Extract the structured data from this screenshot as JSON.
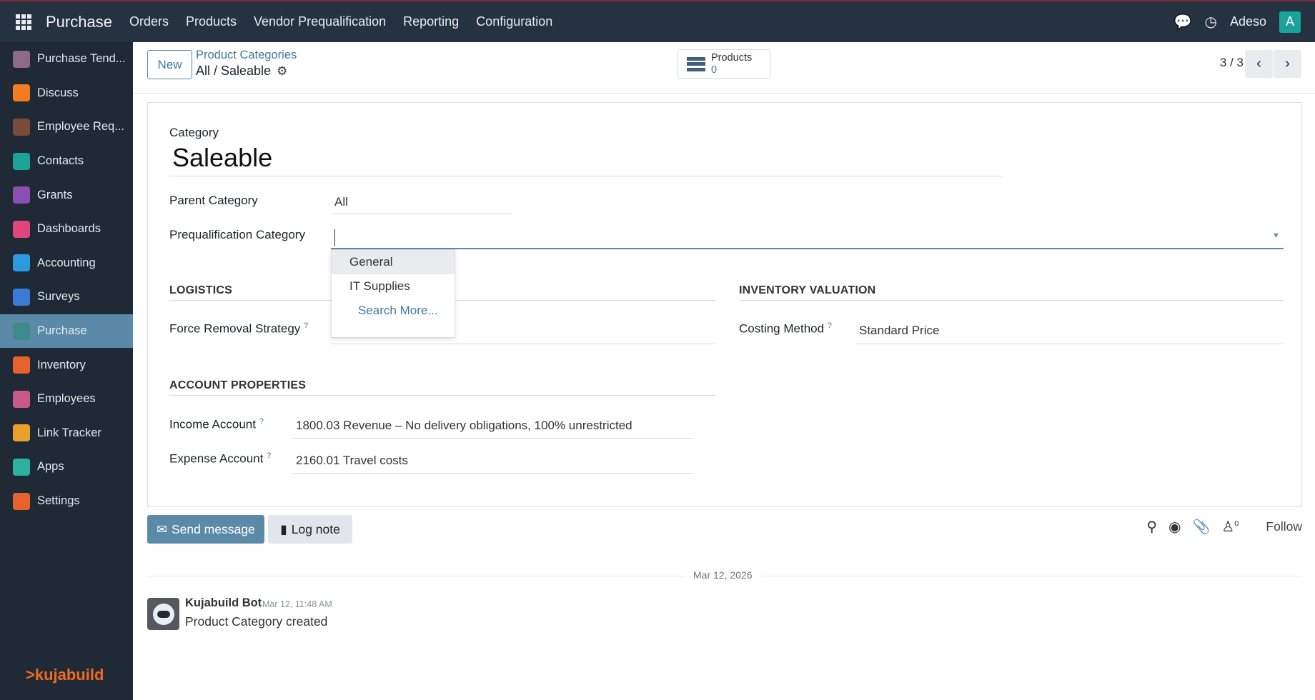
{
  "topbar": {
    "app_name": "Purchase",
    "menu": [
      "Orders",
      "Products",
      "Vendor Prequalification",
      "Reporting",
      "Configuration"
    ],
    "user_name": "Adeso",
    "avatar_letter": "A"
  },
  "sidebar": {
    "items": [
      {
        "label": "Purchase Tend...",
        "icon": "purchase-tender-icon",
        "color": "#8e6a8a"
      },
      {
        "label": "Discuss",
        "icon": "discuss-icon",
        "color": "#f47c20"
      },
      {
        "label": "Employee Req...",
        "icon": "employee-request-icon",
        "color": "#7a4a3a"
      },
      {
        "label": "Contacts",
        "icon": "contacts-icon",
        "color": "#1aa39a"
      },
      {
        "label": "Grants",
        "icon": "grants-icon",
        "color": "#8a4fb0"
      },
      {
        "label": "Dashboards",
        "icon": "dashboards-icon",
        "color": "#e0467c"
      },
      {
        "label": "Accounting",
        "icon": "accounting-icon",
        "color": "#2d9ae0"
      },
      {
        "label": "Surveys",
        "icon": "surveys-icon",
        "color": "#3a7bd5"
      },
      {
        "label": "Purchase",
        "icon": "purchase-icon",
        "color": "#3f8a8a"
      },
      {
        "label": "Inventory",
        "icon": "inventory-icon",
        "color": "#e8632c"
      },
      {
        "label": "Employees",
        "icon": "employees-icon",
        "color": "#c85a8a"
      },
      {
        "label": "Link Tracker",
        "icon": "link-tracker-icon",
        "color": "#e8a22c"
      },
      {
        "label": "Apps",
        "icon": "apps-icon",
        "color": "#2cb0a0"
      },
      {
        "label": "Settings",
        "icon": "settings-icon",
        "color": "#e8632c"
      }
    ],
    "active_index": 8,
    "footer_logo": ">kujabuild"
  },
  "control": {
    "new_label": "New",
    "breadcrumb_parent": "Product Categories",
    "breadcrumb_current": "All / Saleable",
    "smart_button_label": "Products",
    "smart_button_count": "0",
    "pager": "3 / 3"
  },
  "form": {
    "category_label": "Category",
    "category_name": "Saleable",
    "parent_label": "Parent Category",
    "parent_value": "All",
    "prequal_label": "Prequalification Category",
    "prequal_value": "",
    "logistics_title": "LOGISTICS",
    "removal_label": "Force Removal Strategy",
    "valuation_title": "INVENTORY VALUATION",
    "costing_label": "Costing Method",
    "costing_value": "Standard Price",
    "account_title": "ACCOUNT PROPERTIES",
    "income_label": "Income Account",
    "income_value": "1800.03 Revenue – No delivery obligations, 100% unrestricted",
    "expense_label": "Expense Account",
    "expense_value": "2160.01 Travel costs",
    "help_mark": "?"
  },
  "dropdown": {
    "options": [
      "General",
      "IT Supplies"
    ],
    "search_more": "Search More..."
  },
  "chatter": {
    "send_label": "Send message",
    "log_label": "Log note",
    "followers_count": "0",
    "follow_label": "Follow",
    "date": "Mar 12, 2026",
    "author": "Kujabuild Bot",
    "time": "Mar 12, 11:48 AM",
    "message": "Product Category created"
  }
}
